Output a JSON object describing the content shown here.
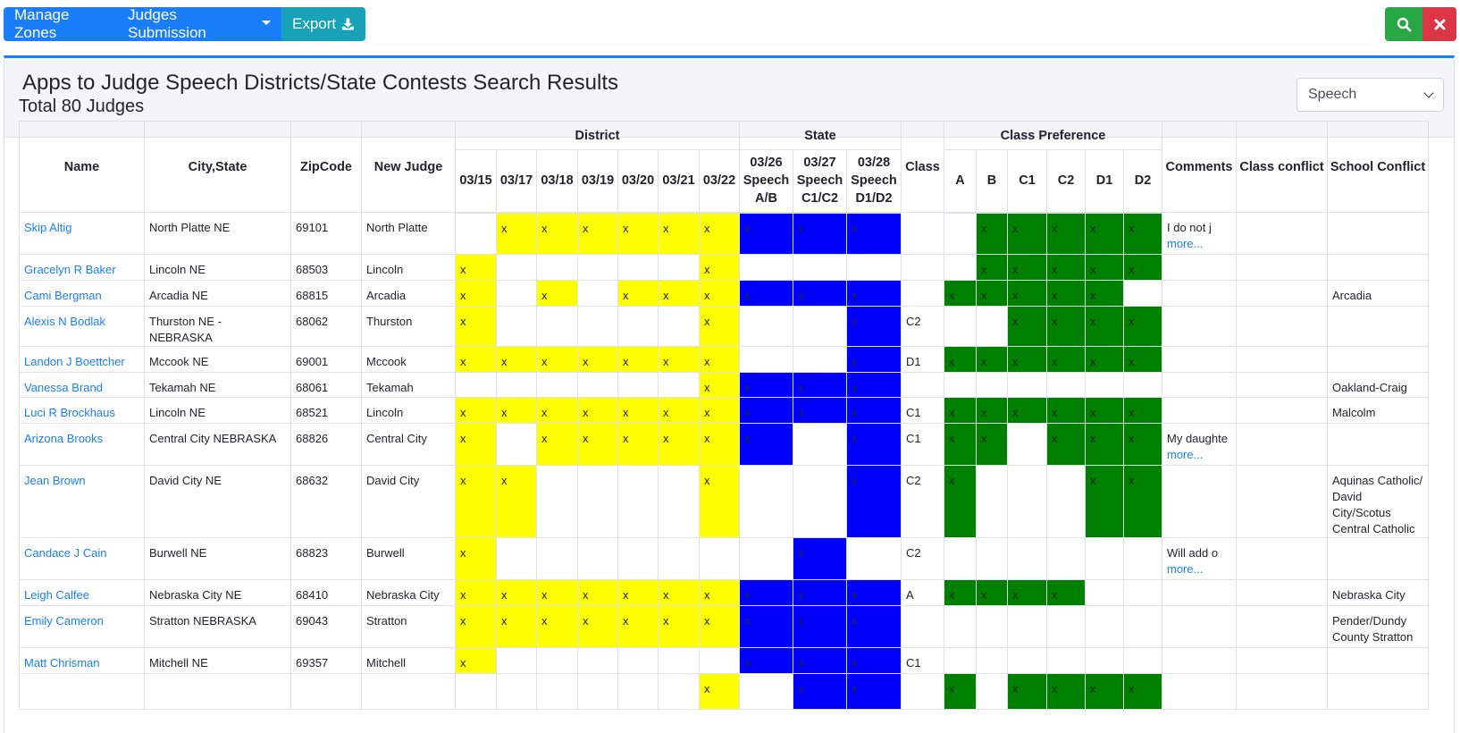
{
  "toolbar": {
    "manage_zones": "Manage Zones",
    "judges_submission": "Judges Submission",
    "export": "Export"
  },
  "page": {
    "title": "Apps to Judge Speech Districts/State Contests Search Results",
    "activity_select": "Speech",
    "total": "Total 80 Judges"
  },
  "colors": {
    "district": "#ffff00",
    "state": "#0000ff",
    "class_pref": "#008000",
    "accent": "#1a7efb"
  },
  "icons": {
    "export": "download-icon",
    "search": "search-icon",
    "close": "close-icon"
  },
  "table": {
    "group_headers": {
      "district": "District",
      "state": "State",
      "class_preference": "Class Preference"
    },
    "headers": {
      "name": "Name",
      "city_state": "City,State",
      "zip": "ZipCode",
      "new_judge": "New Judge",
      "class": "Class",
      "comments": "Comments",
      "class_conflict": "Class conflict",
      "school_conflict": "School Conflict"
    },
    "district_dates": [
      "03/15",
      "03/17",
      "03/18",
      "03/19",
      "03/20",
      "03/21",
      "03/22"
    ],
    "state_dates": [
      [
        "03/26",
        "Speech",
        "A/B"
      ],
      [
        "03/27",
        "Speech",
        "C1/C2"
      ],
      [
        "03/28",
        "Speech",
        "D1/D2"
      ]
    ],
    "class_prefs": [
      "A",
      "B",
      "C1",
      "C2",
      "D1",
      "D2"
    ],
    "mark": "x",
    "more_label": "more...",
    "rows": [
      {
        "name": "Skip Altig",
        "city": "North Platte NE",
        "zip": "69101",
        "new_judge": "North Platte",
        "district": [
          0,
          1,
          1,
          1,
          1,
          1,
          1
        ],
        "state": [
          1,
          1,
          1
        ],
        "cls": "",
        "prefs": [
          0,
          1,
          1,
          1,
          1,
          1
        ],
        "comment": "I do not j",
        "school": ""
      },
      {
        "name": "Gracelyn R Baker",
        "city": "Lincoln NE",
        "zip": "68503",
        "new_judge": "Lincoln",
        "district": [
          1,
          0,
          0,
          0,
          0,
          0,
          1
        ],
        "state": [
          0,
          0,
          0
        ],
        "cls": "",
        "prefs": [
          0,
          1,
          1,
          1,
          1,
          1
        ],
        "comment": "",
        "school": ""
      },
      {
        "name": "Cami Bergman",
        "city": "Arcadia NE",
        "zip": "68815",
        "new_judge": "Arcadia",
        "district": [
          1,
          0,
          1,
          0,
          1,
          1,
          1
        ],
        "state": [
          1,
          1,
          1
        ],
        "cls": "",
        "prefs": [
          1,
          1,
          1,
          1,
          1,
          0
        ],
        "comment": "",
        "school": "Arcadia"
      },
      {
        "name": "Alexis N Bodlak",
        "city": "Thurston NE - NEBRASKA",
        "zip": "68062",
        "new_judge": "Thurston",
        "district": [
          1,
          0,
          0,
          0,
          0,
          0,
          1
        ],
        "state": [
          0,
          0,
          1
        ],
        "cls": "C2",
        "prefs": [
          0,
          0,
          1,
          1,
          1,
          1
        ],
        "comment": "",
        "school": ""
      },
      {
        "name": "Landon J Boettcher",
        "city": "Mccook NE",
        "zip": "69001",
        "new_judge": "Mccook",
        "district": [
          1,
          1,
          1,
          1,
          1,
          1,
          1
        ],
        "state": [
          0,
          0,
          1
        ],
        "cls": "D1",
        "prefs": [
          1,
          1,
          1,
          1,
          1,
          1
        ],
        "comment": "",
        "school": ""
      },
      {
        "name": "Vanessa Brand",
        "city": "Tekamah NE",
        "zip": "68061",
        "new_judge": "Tekamah",
        "district": [
          0,
          0,
          0,
          0,
          0,
          0,
          1
        ],
        "state": [
          1,
          1,
          1
        ],
        "cls": "",
        "prefs": [
          0,
          0,
          0,
          0,
          0,
          0
        ],
        "comment": "",
        "school": "Oakland-Craig"
      },
      {
        "name": "Luci R Brockhaus",
        "city": "Lincoln NE",
        "zip": "68521",
        "new_judge": "Lincoln",
        "district": [
          1,
          1,
          1,
          1,
          1,
          1,
          1
        ],
        "state": [
          1,
          1,
          1
        ],
        "cls": "C1",
        "prefs": [
          1,
          1,
          1,
          1,
          1,
          1
        ],
        "comment": "",
        "school": "Malcolm"
      },
      {
        "name": "Arizona Brooks",
        "city": "Central City NEBRASKA",
        "zip": "68826",
        "new_judge": "Central City",
        "district": [
          1,
          0,
          1,
          1,
          1,
          1,
          1
        ],
        "state": [
          1,
          0,
          1
        ],
        "cls": "C1",
        "prefs": [
          1,
          1,
          0,
          1,
          1,
          1
        ],
        "comment": "My daughte",
        "school": ""
      },
      {
        "name": "Jean Brown",
        "city": "David City NE",
        "zip": "68632",
        "new_judge": "David City",
        "district": [
          1,
          1,
          0,
          0,
          0,
          0,
          1
        ],
        "state": [
          0,
          0,
          1
        ],
        "cls": "C2",
        "prefs": [
          1,
          0,
          0,
          0,
          1,
          1
        ],
        "comment": "",
        "school": "Aquinas Catholic/ David City/Scotus Central Catholic"
      },
      {
        "name": "Candace J Cain",
        "city": "Burwell NE",
        "zip": "68823",
        "new_judge": "Burwell",
        "district": [
          1,
          0,
          0,
          0,
          0,
          0,
          0
        ],
        "state": [
          0,
          1,
          0
        ],
        "cls": "C2",
        "prefs": [
          0,
          0,
          0,
          0,
          0,
          0
        ],
        "comment": "Will add o",
        "school": ""
      },
      {
        "name": "Leigh Calfee",
        "city": "Nebraska City NE",
        "zip": "68410",
        "new_judge": "Nebraska City",
        "district": [
          1,
          1,
          1,
          1,
          1,
          1,
          1
        ],
        "state": [
          1,
          1,
          1
        ],
        "cls": "A",
        "prefs": [
          1,
          1,
          1,
          1,
          0,
          0
        ],
        "comment": "",
        "school": "Nebraska City"
      },
      {
        "name": "Emily Cameron",
        "city": "Stratton NEBRASKA",
        "zip": "69043",
        "new_judge": "Stratton",
        "district": [
          1,
          1,
          1,
          1,
          1,
          1,
          1
        ],
        "state": [
          1,
          1,
          1
        ],
        "cls": "",
        "prefs": [
          0,
          0,
          0,
          0,
          0,
          0
        ],
        "comment": "",
        "school": "Pender/Dundy County Stratton"
      },
      {
        "name": "Matt Chrisman",
        "city": "Mitchell NE",
        "zip": "69357",
        "new_judge": "Mitchell",
        "district": [
          1,
          0,
          0,
          0,
          0,
          0,
          0
        ],
        "state": [
          1,
          1,
          1
        ],
        "cls": "C1",
        "prefs": [
          0,
          0,
          0,
          0,
          0,
          0
        ],
        "comment": "",
        "school": ""
      },
      {
        "name": "",
        "city": "",
        "zip": "",
        "new_judge": "",
        "district": [
          0,
          0,
          0,
          0,
          0,
          0,
          1
        ],
        "state": [
          0,
          1,
          1
        ],
        "cls": "",
        "prefs": [
          1,
          0,
          1,
          1,
          1,
          1
        ],
        "comment": "",
        "school": ""
      }
    ]
  }
}
